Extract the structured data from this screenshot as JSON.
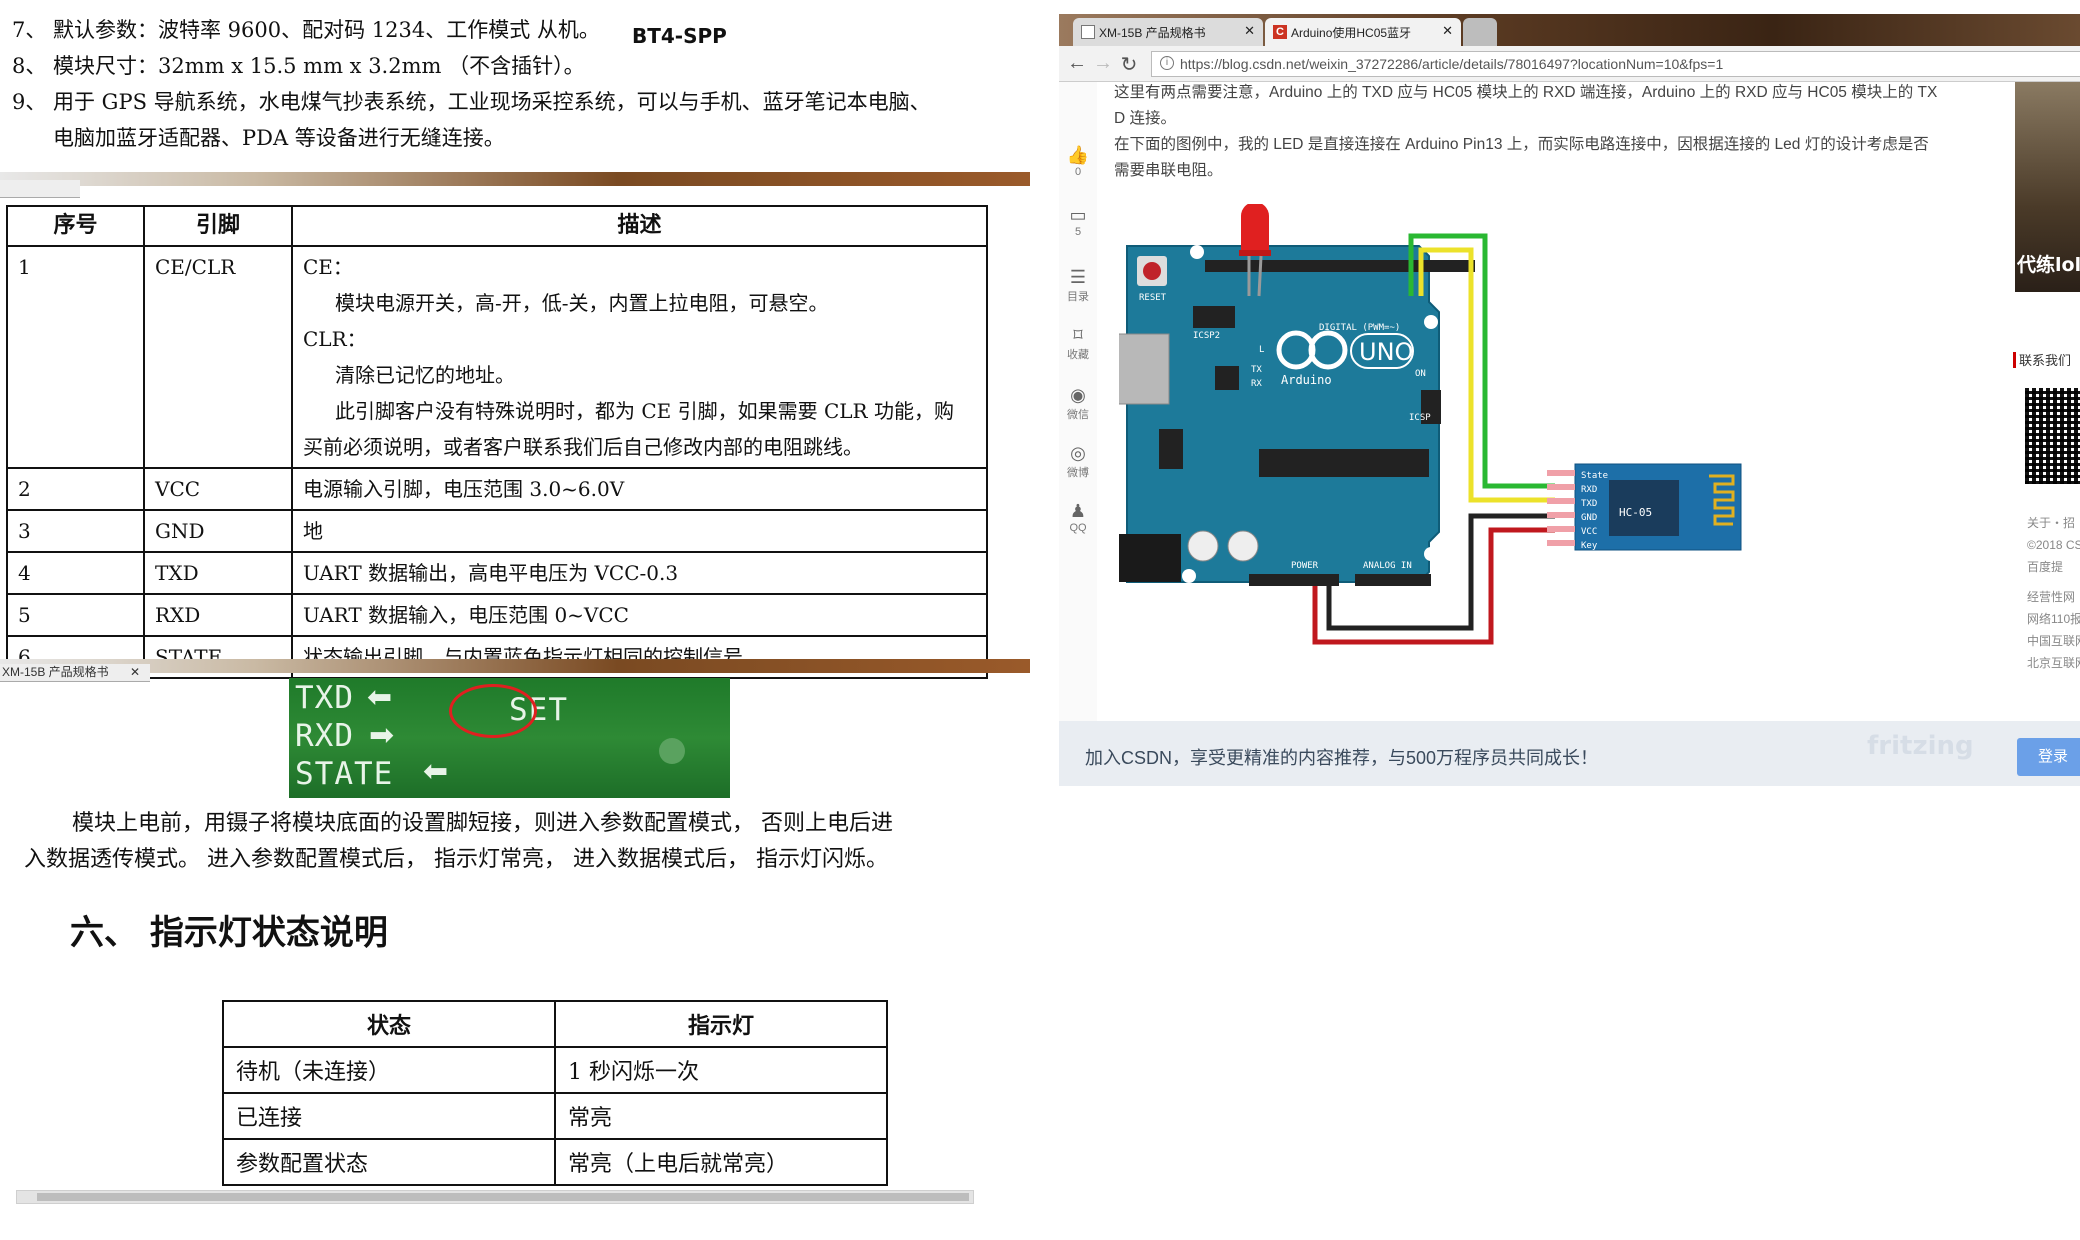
{
  "doc": {
    "spec_items": [
      {
        "num": "7、",
        "text": "默认参数：波特率  9600、配对码  1234、工作模式  从机。"
      },
      {
        "num": "8、",
        "text": "模块尺寸：32mm x 15.5 mm x 3.2mm  （不含插针）。"
      },
      {
        "num": "9、",
        "text": "用于  GPS  导航系统，水电煤气抄表系统，工业现场采控系统，可以与手机、蓝牙笔记本电脑、"
      },
      {
        "num": "",
        "text": "电脑加蓝牙适配器、PDA 等设备进行无缝连接。"
      }
    ],
    "module_name": "BT4-SPP",
    "tab_label": "XM-15B 产品规格书",
    "pin_table": {
      "headers": [
        "序号",
        "引脚",
        "描述"
      ],
      "rows": [
        {
          "num": "1",
          "pin": "CE/CLR",
          "desc": [
            "CE：",
            "模块电源开关，高-开，低-关，内置上拉电阻，可悬空。",
            "CLR：",
            "清除已记忆的地址。",
            "此引脚客户没有特殊说明时，都为 CE 引脚，如果需要 CLR 功能，购",
            "买前必须说明，或者客户联系我们后自己修改内部的电阻跳线。"
          ]
        },
        {
          "num": "2",
          "pin": "VCC",
          "desc": [
            "电源输入引脚，电压范围 3.0~6.0V"
          ]
        },
        {
          "num": "3",
          "pin": "GND",
          "desc": [
            "地"
          ]
        },
        {
          "num": "4",
          "pin": "TXD",
          "desc": [
            "UART 数据输出，高电平电压为 VCC-0.3"
          ]
        },
        {
          "num": "5",
          "pin": "RXD",
          "desc": [
            "UART 数据输入，电压范围 0~VCC"
          ]
        },
        {
          "num": "6",
          "pin": "STATE",
          "desc": [
            "状态输出引脚，与内置蓝色指示灯相同的控制信号。"
          ]
        }
      ]
    },
    "photo_labels": {
      "txd": "TXD",
      "rxd": "RXD",
      "state": "STATE",
      "set": "SET"
    },
    "paragraph": [
      "模块上电前，用镊子将模块底面的设置脚短接，则进入参数配置模式，  否则上电后进",
      "入数据透传模式。  进入参数配置模式后，  指示灯常亮，  进入数据模式后，  指示灯闪烁。"
    ],
    "section_title": "六、  指示灯状态说明",
    "led_table": {
      "headers": [
        "状态",
        "指示灯"
      ],
      "rows": [
        [
          "待机（未连接）",
          "1 秒闪烁一次"
        ],
        [
          "已连接",
          "常亮"
        ],
        [
          "参数配置状态",
          "常亮（上电后就常亮）"
        ]
      ]
    }
  },
  "browser": {
    "tabs": [
      {
        "label": "XM-15B 产品规格书",
        "active": false
      },
      {
        "label": "Arduino使用HC05蓝牙",
        "active": true
      }
    ],
    "url": "https://blog.csdn.net/weixin_37272286/article/details/78016497?locationNum=10&fps=1",
    "side_items": [
      {
        "icon": "thumbs-up-icon",
        "label": "0"
      },
      {
        "icon": "comment-icon",
        "label": "5"
      },
      {
        "icon": "toc-icon",
        "label": "目录"
      },
      {
        "icon": "bookmark-icon",
        "label": "收藏"
      },
      {
        "icon": "wechat-icon",
        "label": "微信"
      },
      {
        "icon": "weibo-icon",
        "label": "微博"
      },
      {
        "icon": "qq-icon",
        "label": "QQ"
      }
    ],
    "article_lines": [
      "这里有两点需要注意，Arduino 上的 TXD 应与 HC05 模块上的 RXD 端连接，Arduino 上的 RXD 应与 HC05 模块上的 TX",
      "D 连接。",
      "在下面的图例中，我的 LED 是直接连接在 Arduino Pin13 上，而实际电路连接中，因根据连接的 Led 灯的设计考虑是否",
      "需要串联电阻。"
    ],
    "ad_text": "代练lol",
    "contact_title": "联系我们",
    "right_links": [
      "关于・招",
      "©2018 CS",
      "百度提",
      "经营性网",
      "网络110报",
      "中国互联网",
      "北京互联网"
    ],
    "banner_text": "加入CSDN，享受更精准的内容推荐，与500万程序员共同成长！",
    "login_label": "登录",
    "watermark": "fritzing",
    "board": {
      "reset": "RESET",
      "icsp2": "ICSP2",
      "digital": "DIGITAL (PWM=~)",
      "uno": "UNO",
      "brand": "Arduino",
      "power": "POWER",
      "analog": "ANALOG IN",
      "on": "ON",
      "tx": "TX",
      "rx": "RX",
      "l": "L",
      "icsp": "ICSP"
    },
    "hc05": {
      "name": "HC-05",
      "pins": [
        "State",
        "RXD",
        "TXD",
        "GND",
        "VCC",
        "Key"
      ]
    }
  }
}
